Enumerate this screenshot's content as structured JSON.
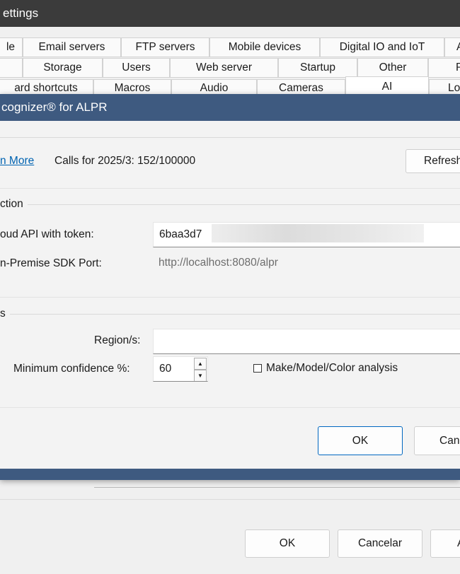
{
  "settings_window": {
    "title": "ettings",
    "tab_rows": [
      [
        "le",
        "Email servers",
        "FTP servers",
        "Mobile devices",
        "Digital IO and IoT",
        "A"
      ],
      [
        "",
        "Storage",
        "Users",
        "Web server",
        "Startup",
        "Other",
        "P"
      ],
      [
        "ard shortcuts",
        "Macros",
        "Audio",
        "Cameras",
        "AI",
        "Lo"
      ]
    ],
    "selected_tab": "AI",
    "footer": {
      "ok_label": "OK",
      "cancel_label": "Cancelar",
      "apply_label": "A"
    }
  },
  "dialog": {
    "title": "cognizer® for ALPR",
    "usage": {
      "learn_more_label": "n More",
      "calls_text": "Calls for 2025/3: 152/100000",
      "refresh_label": "Refresh"
    },
    "connection": {
      "group_label": "ction",
      "cloud_label": "oud API with token:",
      "cloud_token_value": "6baa3d7",
      "onprem_label": "n-Premise SDK Port:",
      "onprem_value": "http://localhost:8080/alpr"
    },
    "options": {
      "group_label": "s",
      "region_label": "Region/s:",
      "region_value": "",
      "min_conf_label": "Minimum confidence %:",
      "min_conf_value": "60",
      "mmc_label": "Make/Model/Color analysis",
      "mmc_checked": false
    },
    "buttons": {
      "ok_label": "OK",
      "cancel_label": "Can"
    }
  },
  "colors": {
    "dialog_titlebar": "#3e5a80",
    "settings_titlebar": "#3b3b3b",
    "link": "#0063b1",
    "primary_border": "#0067c0"
  }
}
